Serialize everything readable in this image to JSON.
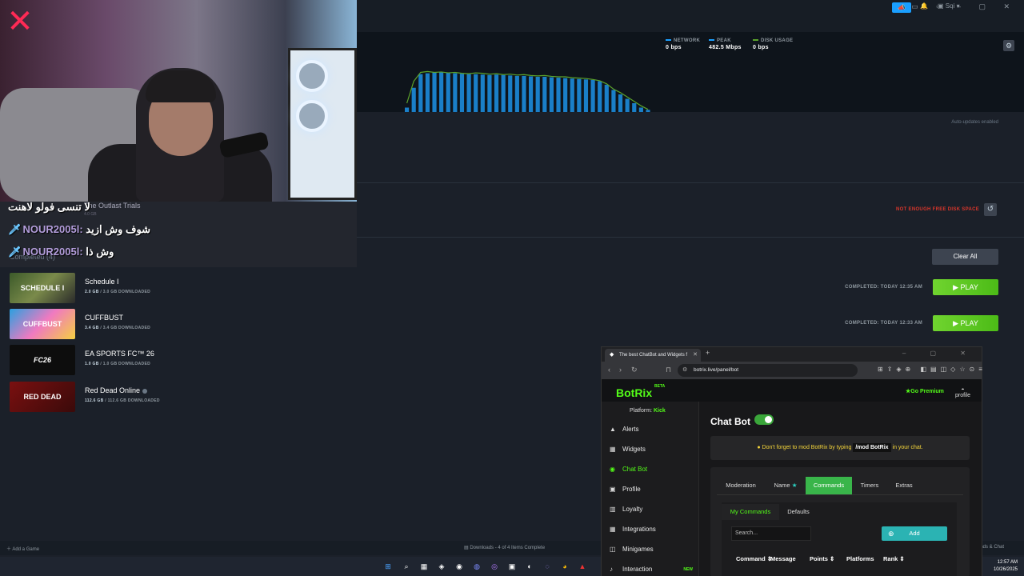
{
  "topbar": {
    "user_label": "Sqi"
  },
  "graph": {
    "network_label": "NETWORK",
    "network_value": "0 bps",
    "peak_label": "PEAK",
    "peak_value": "482.5 Mbps",
    "disk_label": "DISK USAGE",
    "disk_value": "0 bps",
    "colors": {
      "network": "#1a9fff",
      "peak": "#1a9fff",
      "disk": "#5ba32b"
    }
  },
  "status": {
    "auto_updates": "Auto-updates enabled",
    "disk_warning": "NOT ENOUGH FREE DISK SPACE"
  },
  "queued": {
    "title": "The Outlast Trials",
    "sub": "4.0 GB"
  },
  "completed": {
    "header": "Completed (4)",
    "clear_all": "Clear All",
    "games": [
      {
        "name": "Schedule I",
        "size": "2.0 GB",
        "total": "3.0 GB DOWNLOADED",
        "status": "COMPLETED: TODAY 12:35 AM",
        "action": "PLAY",
        "thumb": "SCHEDULE I"
      },
      {
        "name": "CUFFBUST",
        "size": "3.4 GB",
        "total": "3.4 GB DOWNLOADED",
        "status": "COMPLETED: TODAY 12:33 AM",
        "action": "PLAY",
        "thumb": "CUFFBUST"
      },
      {
        "name": "EA SPORTS FC™ 26",
        "size": "1.0 GB",
        "total": "1.0 GB DOWNLOADED",
        "thumb": "FC26"
      },
      {
        "name": "Red Dead Online",
        "size": "112.6 GB",
        "total": "112.6 GB DOWNLOADED",
        "thumb": "RED DEAD"
      }
    ]
  },
  "bottombar": {
    "add_game": "Add a Game",
    "downloads": "Downloads - 4 of 4 Items Complete",
    "friends": "ends & Chat"
  },
  "taskbar": {
    "time": "12:57 AM",
    "date": "10/26/2025"
  },
  "chat": [
    {
      "name": "",
      "message": "لا تنسى فولو لاهنت"
    },
    {
      "name": "NOUR2005l:",
      "message": "شوف وش ازيد"
    },
    {
      "name": "NOUR2005l:",
      "message": "وش ذا"
    }
  ],
  "browser": {
    "tab_title": "The best ChatBot and Widgets f",
    "url": "botrix.live/panel/bot"
  },
  "botrix": {
    "logo": "BotRix",
    "beta": "BETA",
    "premium": "Go Premium",
    "profile": "profile",
    "platform_label": "Platform:",
    "platform_value": "Kick",
    "nav": [
      "Alerts",
      "Widgets",
      "Chat Bot",
      "Profile",
      "Loyalty",
      "Integrations",
      "Minigames",
      "Interaction"
    ],
    "nav_new": "NEW",
    "title": "Chat Bot",
    "notice_pre": "Don't forget to mod BotRix by typing",
    "notice_cmd": "/mod BotRix",
    "notice_post": "in your chat.",
    "tabs": [
      "Moderation",
      "Name",
      "Commands",
      "Timers",
      "Extras"
    ],
    "subtabs": [
      "My Commands",
      "Defaults"
    ],
    "search_placeholder": "Search...",
    "add": "Add",
    "columns": [
      "Command",
      "Message",
      "Points",
      "Platforms",
      "Rank"
    ]
  },
  "chart_data": {
    "type": "area",
    "series": [
      {
        "name": "PEAK",
        "values": [
          10,
          55,
          86,
          88,
          90,
          90,
          89,
          88,
          87,
          86,
          86,
          85,
          84,
          85,
          84,
          83,
          82,
          82,
          81,
          80,
          80,
          79,
          78,
          77,
          76,
          75,
          74,
          73,
          70,
          62,
          50,
          40,
          30,
          20,
          10,
          5
        ]
      },
      {
        "name": "DISK USAGE",
        "values": [
          20,
          70,
          90,
          92,
          90,
          91,
          89,
          90,
          88,
          87,
          89,
          88,
          86,
          87,
          85,
          86,
          84,
          85,
          83,
          82,
          83,
          81,
          80,
          80,
          78,
          77,
          76,
          74,
          71,
          64,
          52,
          44,
          34,
          24,
          14,
          6
        ]
      }
    ],
    "ylim": [
      0,
      100
    ]
  }
}
